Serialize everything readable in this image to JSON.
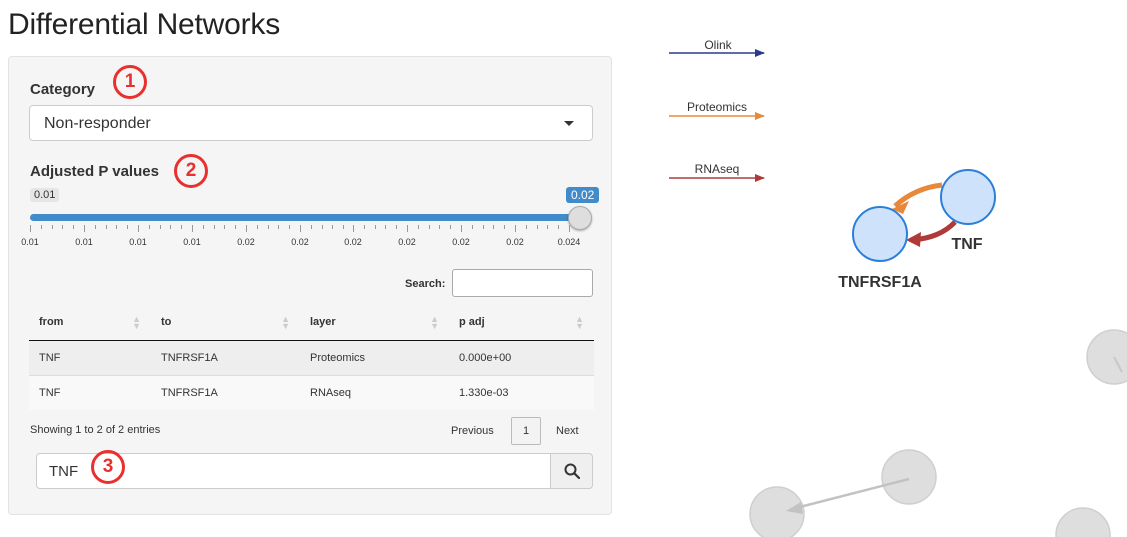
{
  "title": "Differential Networks",
  "category": {
    "label": "Category",
    "selected": "Non-responder",
    "callout": "1"
  },
  "pvalues": {
    "label": "Adjusted P values",
    "callout": "2",
    "min_label": "0.01",
    "max_label": "0.02",
    "tick_labels": [
      "0.01",
      "0.01",
      "0.01",
      "0.01",
      "0.02",
      "0.02",
      "0.02",
      "0.02",
      "0.02",
      "0.02",
      "0.024"
    ]
  },
  "table": {
    "search_label": "Search:",
    "columns": [
      "from",
      "to",
      "layer",
      "p adj"
    ],
    "rows": [
      [
        "TNF",
        "TNFRSF1A",
        "Proteomics",
        "0.000e+00"
      ],
      [
        "TNF",
        "TNFRSF1A",
        "RNAseq",
        "1.330e-03"
      ]
    ],
    "info": "Showing 1 to 2 of 2 entries",
    "prev": "Previous",
    "page": "1",
    "next": "Next"
  },
  "gene_search": {
    "value": "TNF",
    "callout": "3"
  },
  "legend": [
    {
      "name": "Olink",
      "color": "#2b3a8a"
    },
    {
      "name": "Proteomics",
      "color": "#e8883a"
    },
    {
      "name": "RNAseq",
      "color": "#b03a3a"
    }
  ],
  "network": {
    "nodes": [
      "TNF",
      "TNFRSF1A"
    ],
    "node_fill": "#cfe2fb",
    "node_stroke": "#2b7fd9",
    "inactive_color": "#d9d9d9"
  }
}
